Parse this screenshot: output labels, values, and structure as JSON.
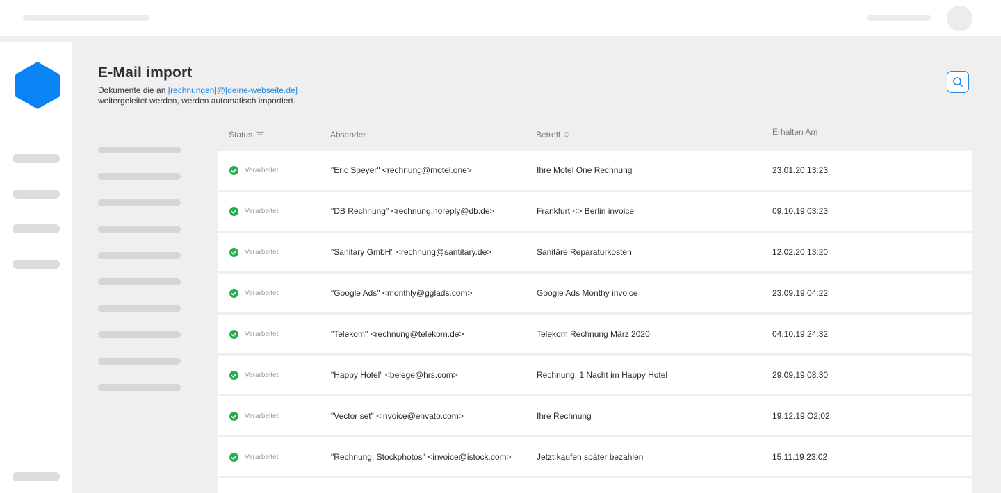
{
  "colors": {
    "accent": "#1e88e5",
    "logo": "#0a84f5",
    "success": "#27ae4f"
  },
  "header": {
    "title": "E-Mail import",
    "subtitle_prefix": "Dokumente die an ",
    "email_link": "[rechnungen]@[deine-webseite.de]",
    "subtitle_suffix": "weitergeleitet werden, werden automatisch importiert.",
    "search_icon": "search-icon"
  },
  "table": {
    "columns": {
      "status": "Status",
      "sender": "Absender",
      "subject": "Betreff",
      "received": "Erhalten Am"
    },
    "rows": [
      {
        "status": "Verarbeitet",
        "sender": "\"Eric Speyer\" <rechnung@motel.one>",
        "subject": "Ihre Motel One Rechnung",
        "date": "23.01.20 13:23"
      },
      {
        "status": "Verarbeitet",
        "sender": "\"DB Rechnung\" <rechnung.noreply@db.de>",
        "subject": "Frankfurt <> Berlin invoice",
        "date": "09.10.19 03:23"
      },
      {
        "status": "Verarbeitet",
        "sender": "\"Sanitary GmbH\" <rechnung@santitary.de>",
        "subject": "Sanitäre Reparaturkosten",
        "date": "12.02.20 13:20"
      },
      {
        "status": "Verarbeitet",
        "sender": "\"Google Ads\" <monthly@gglads.com>",
        "subject": "Google Ads Monthy invoice",
        "date": "23.09.19 04:22"
      },
      {
        "status": "Verarbeitet",
        "sender": "\"Telekom\" <rechnung@telekom.de>",
        "subject": "Telekom Rechnung März 2020",
        "date": "04.10.19 24:32"
      },
      {
        "status": "Verarbeitet",
        "sender": "\"Happy Hotel\" <belege@hrs.com>",
        "subject": "Rechnung: 1 Nacht im Happy Hotel",
        "date": "29.09.19 08:30"
      },
      {
        "status": "Verarbeitet",
        "sender": "\"Vector set\" <invoice@envato.com>",
        "subject": "Ihre Rechnung",
        "date": "19.12.19 O2:02"
      },
      {
        "status": "Verarbeitet",
        "sender": "\"Rechnung: Stockphotos\" <invoice@istock.com>",
        "subject": "Jetzt kaufen später bezahlen",
        "date": "15.11.19 23:02"
      }
    ]
  }
}
